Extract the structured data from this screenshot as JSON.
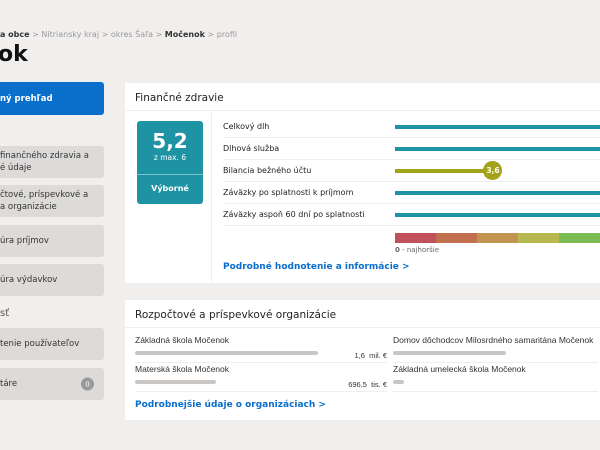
{
  "breadcrumb": {
    "items": [
      "a obce",
      "Nitriansky kraj",
      "okres Šaľa",
      "Močenok",
      "profil"
    ]
  },
  "page_title": "ok",
  "sidebar": {
    "items": [
      {
        "label": "ný prehľad",
        "active": true
      },
      {
        "label": "finančného zdravia a é údaje"
      },
      {
        "label": "čtové, príspevkové a a organizácie"
      },
      {
        "label": "úra príjmov"
      },
      {
        "label": "úra výdavkov"
      }
    ],
    "section": "sť",
    "items2": [
      {
        "label": "tenie používateľov"
      },
      {
        "label": "táre",
        "badge": "0"
      }
    ]
  },
  "health": {
    "title": "Finančné zdravie",
    "score": "5,2",
    "max": "z max. 6",
    "verdict": "Výborné",
    "rows": [
      {
        "label": "Celkový dlh",
        "value": 6
      },
      {
        "label": "Dlhová služba",
        "value": 6
      },
      {
        "label": "Bilancia bežného účtu",
        "value": 3.6,
        "value_label": "3,6",
        "color": "#a3a31a"
      },
      {
        "label": "Záväzky po splatnosti k príjmom",
        "value": 6
      },
      {
        "label": "Záväzky aspoň 60 dní po splatnosti",
        "value": 6
      }
    ],
    "scale_colors": [
      "#c0505c",
      "#c0704f",
      "#c0954f",
      "#b8b850",
      "#7dbb55"
    ],
    "scale_min": "0",
    "scale_min_label": " - najhoršie",
    "link": "Podrobné hodnotenie a informácie >",
    "accent": "#1d93a3"
  },
  "orgs": {
    "title": "Rozpočtové a príspevkové organizácie",
    "items": [
      {
        "name": "Základná škola Močenok",
        "value": "1,6",
        "unit": "mil. €",
        "share": 1
      },
      {
        "name": "Domov dôchodcov Milosrdného samaritána Močenok",
        "share": 0.62
      },
      {
        "name": "Materská škola Močenok",
        "value": "696,5",
        "unit": "tis. €",
        "share": 0.44
      },
      {
        "name": "Základná umelecká škola Močenok",
        "share": 0.06
      }
    ],
    "link": "Podrobnejšie údaje o organizáciach >"
  }
}
